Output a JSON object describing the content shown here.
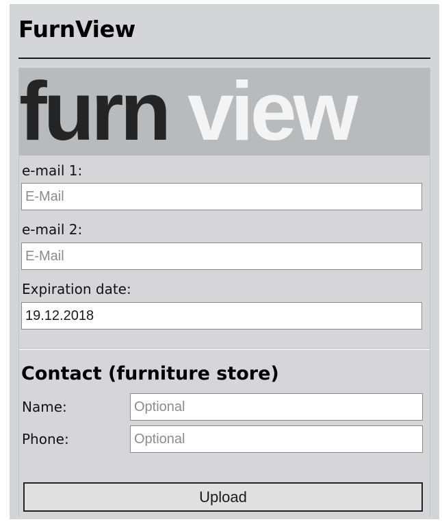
{
  "app": {
    "title": "FurnView"
  },
  "logo": {
    "word_dark": "furn",
    "word_light": "view"
  },
  "form": {
    "email1": {
      "label": "e-mail 1:",
      "placeholder": "E-Mail",
      "value": ""
    },
    "email2": {
      "label": "e-mail 2:",
      "placeholder": "E-Mail",
      "value": ""
    },
    "expiration": {
      "label": "Expiration date:",
      "placeholder": "",
      "value": "19.12.2018"
    }
  },
  "contact": {
    "title": "Contact (furniture store)",
    "name": {
      "label": "Name:",
      "placeholder": "Optional",
      "value": ""
    },
    "phone": {
      "label": "Phone:",
      "placeholder": "Optional",
      "value": ""
    }
  },
  "actions": {
    "upload_label": "Upload"
  },
  "colors": {
    "panel_background": "#d4d5d7",
    "logo_background": "#b9babc",
    "logo_dark": "#242424",
    "logo_light": "#f4f4f4"
  }
}
